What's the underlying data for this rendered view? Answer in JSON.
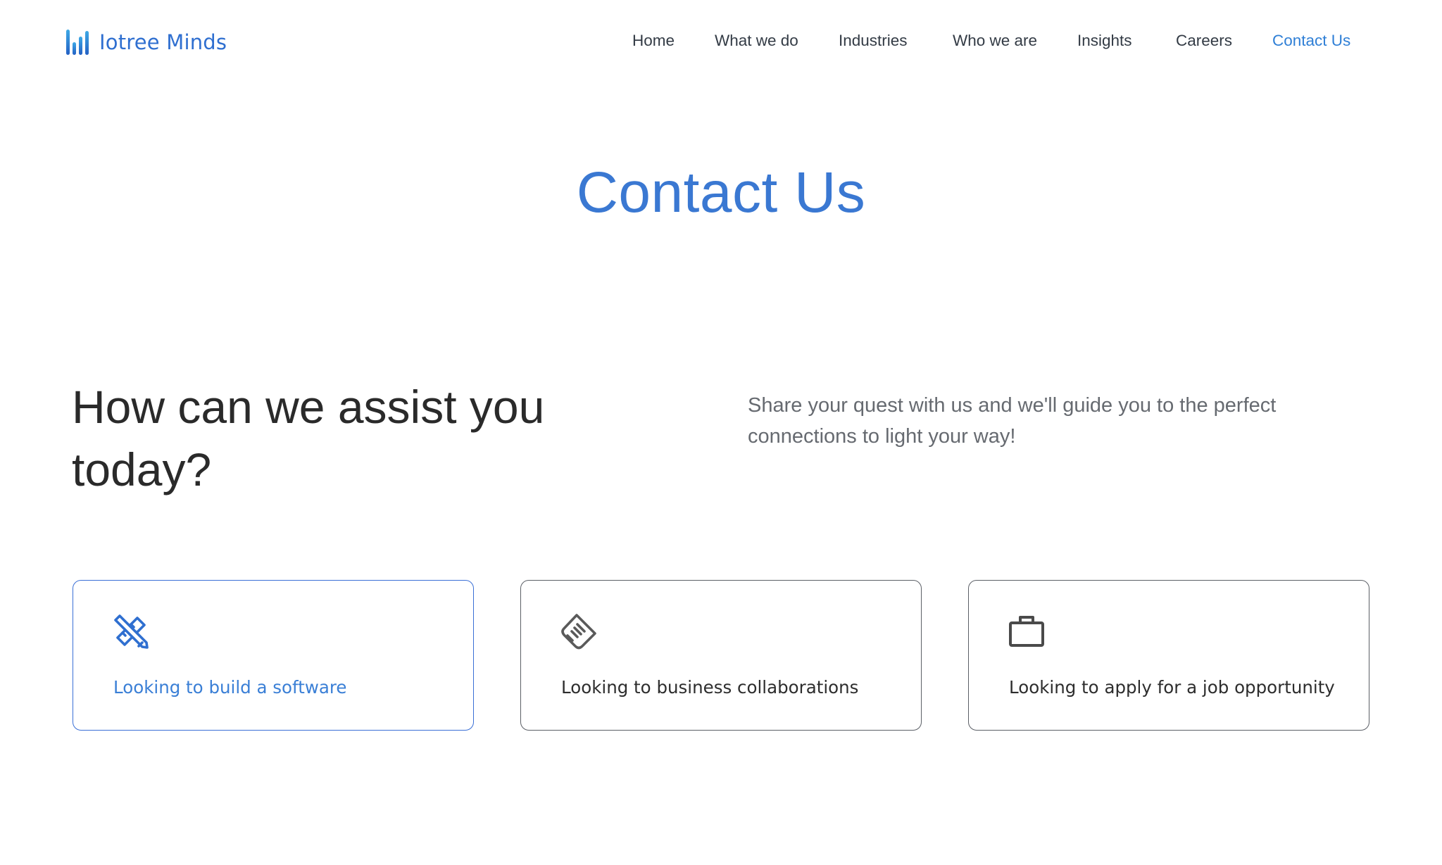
{
  "brand": {
    "name": "Iotree Minds",
    "logo_icon": "bar-chart-logo-icon",
    "logo_color": "#2f6fd0"
  },
  "nav": {
    "items": [
      {
        "label": "Home",
        "active": false
      },
      {
        "label": "What we do",
        "active": false
      },
      {
        "label": "Industries",
        "active": false
      },
      {
        "label": "Who we are",
        "active": false
      },
      {
        "label": "Insights",
        "active": false
      },
      {
        "label": "Careers",
        "active": false
      },
      {
        "label": "Contact Us",
        "active": true
      }
    ],
    "active_color": "#2f7fd6"
  },
  "hero": {
    "title": "Contact Us",
    "title_color": "#3a78d2"
  },
  "assist": {
    "heading": "How can we assist you today?",
    "subtitle": "Share your quest with us and we'll guide you to the perfect connections to light your way!"
  },
  "options": [
    {
      "label": "Looking to build a software",
      "icon": "pencil-ruler-icon",
      "selected": true
    },
    {
      "label": "Looking to business collaborations",
      "icon": "handshake-icon",
      "selected": false
    },
    {
      "label": "Looking to apply for a job opportunity",
      "icon": "briefcase-icon",
      "selected": false
    }
  ],
  "colors": {
    "accent": "#3a6fd6",
    "text_dark": "#2a2a2a",
    "text_muted": "#666a70",
    "border": "#5b5f66"
  }
}
